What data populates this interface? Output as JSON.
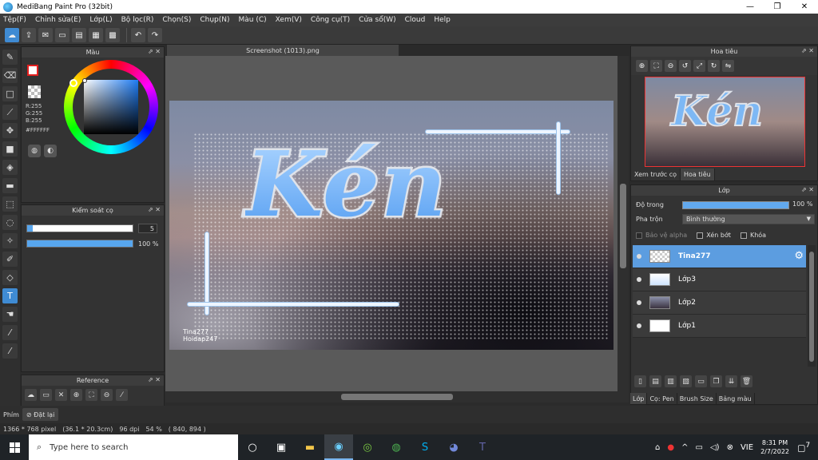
{
  "window": {
    "title": "MediBang Paint Pro (32bit)",
    "minimize": "—",
    "restore": "❐",
    "close": "✕"
  },
  "menu": [
    "Tệp(F)",
    "Chỉnh sửa(E)",
    "Lớp(L)",
    "Bộ lọc(R)",
    "Chọn(S)",
    "Chụp(N)",
    "Màu (C)",
    "Xem(V)",
    "Công cụ(T)",
    "Cửa sổ(W)",
    "Cloud",
    "Help"
  ],
  "color_panel": {
    "title": "Màu",
    "r": "R:255",
    "g": "G:255",
    "b": "B:255",
    "hex": "#FFFFFF"
  },
  "brush_panel": {
    "title": "Kiểm soát cọ",
    "size_value": "5",
    "size_fraction": 0.05,
    "opacity_value": "100 %",
    "opacity_fraction": 1.0
  },
  "reference_panel": {
    "title": "Reference"
  },
  "document": {
    "tab_label": "Screenshot (1013).png",
    "canvas_text": "Kén",
    "watermark_line1": "Tina277",
    "watermark_line2": "Hoidap247"
  },
  "navigator": {
    "title": "Hoa tiêu",
    "preview_text": "Kén",
    "tabs": [
      "Xem trước cọ",
      "Hoa tiêu"
    ]
  },
  "layer_panel": {
    "title": "Lớp",
    "opacity_label": "Độ trong",
    "opacity_value": "100 %",
    "opacity_fraction": 1.0,
    "blend_label": "Pha trộn",
    "blend_value": "Bình thường",
    "protect_alpha": "Bảo vệ alpha",
    "clipping": "Xén bớt",
    "lock": "Khóa",
    "layers": [
      {
        "name": "Tina277",
        "selected": true
      },
      {
        "name": "Lớp3",
        "selected": false
      },
      {
        "name": "Lớp2",
        "selected": false
      },
      {
        "name": "Lớp1",
        "selected": false
      }
    ]
  },
  "bottom_tabs": [
    "Lớp",
    "Cọ: Pen",
    "Brush Size",
    "Bảng màu"
  ],
  "film_strip": {
    "label": "Phím",
    "reset": "Đặt lại"
  },
  "status": {
    "dimensions": "1366 * 768 pixel",
    "size_cm": "(36.1 * 20.3cm)",
    "dpi": "96 dpi",
    "zoom": "54 %",
    "cursor": "( 840, 894 )"
  },
  "taskbar": {
    "search_placeholder": "Type here to search",
    "language": "VIE",
    "time": "8:31 PM",
    "date": "2/7/2022",
    "notification_count": "7"
  },
  "colors": {
    "accent": "#3f8bd3",
    "selected_layer": "#5c9de0",
    "text_fill": "#7db8f5"
  }
}
